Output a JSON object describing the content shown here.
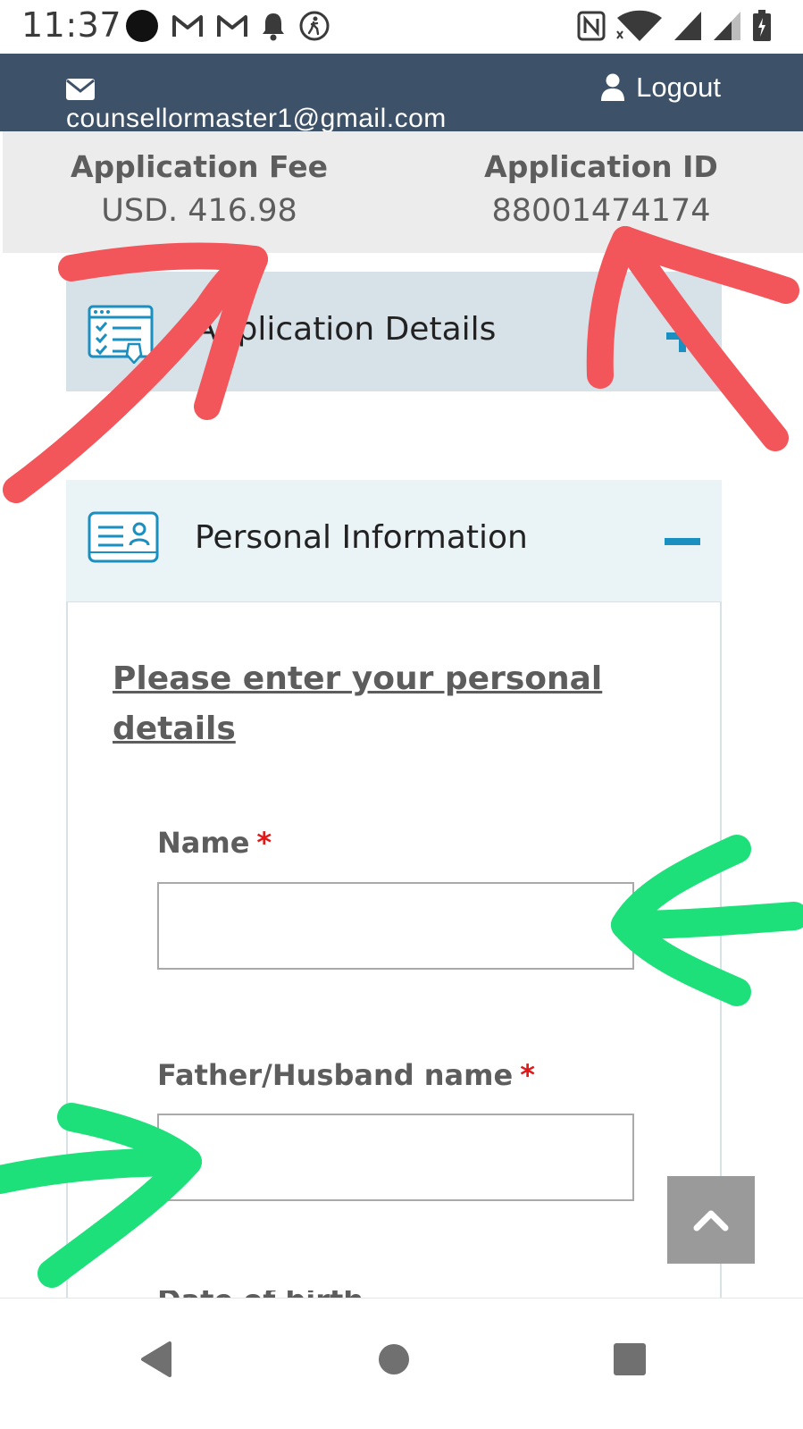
{
  "status_bar": {
    "time": "11:37",
    "left_icons": [
      "record-dot-icon",
      "gmail-icon",
      "gmail-icon",
      "notification-bell-icon",
      "activity-icon"
    ],
    "right_icons": [
      "nfc-icon",
      "wifi-icon",
      "signal-icon",
      "signal-icon",
      "battery-icon"
    ]
  },
  "header": {
    "email": "counsellormaster1@gmail.com",
    "logout_label": "Logout",
    "background": "#3d5168"
  },
  "fee_band": {
    "fee_label": "Application Fee",
    "fee_value": "USD. 416.98",
    "id_label": "Application ID",
    "id_value": "88001474174"
  },
  "accordion": {
    "application_details": {
      "title": "Application Details",
      "toggle": "plus-icon"
    },
    "personal_information": {
      "title": "Personal Information",
      "toggle": "minus-icon"
    }
  },
  "personal_form": {
    "heading": "Please enter your personal details",
    "name_label": "Name",
    "father_label": "Father/Husband name",
    "required_mark": "*",
    "name_value": "",
    "father_value": ""
  },
  "colors": {
    "annotation_red": "#f2555a",
    "annotation_green": "#1ee07a",
    "accent_blue": "#1a8fc0"
  },
  "nav_bar": {
    "back": "back-triangle-icon",
    "home": "home-circle-icon",
    "recents": "recents-square-icon"
  }
}
